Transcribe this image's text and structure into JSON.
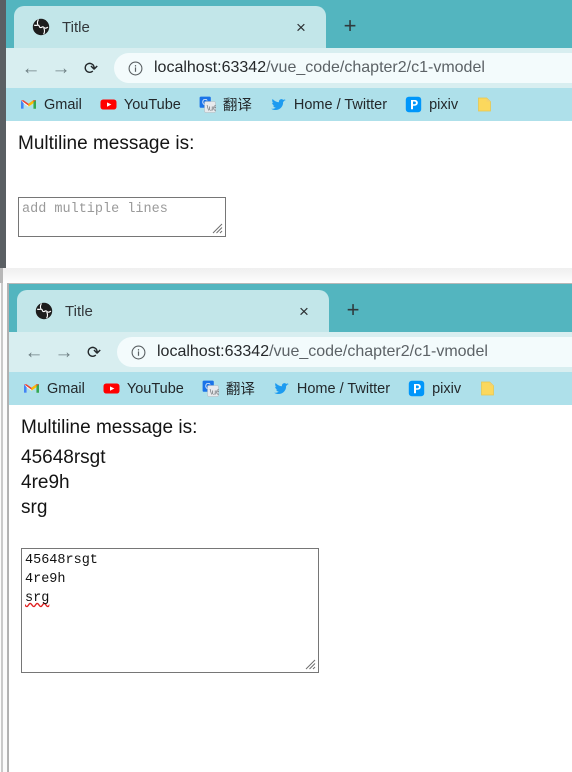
{
  "theme": {
    "tabstrip_color": "#53b5bf",
    "active_tab_color": "#c2e6e9",
    "toolbar_color": "#d8eef0",
    "bookmarks_color": "#aee0ea",
    "omnibox_color": "#f3fbfc",
    "page_background": "#ffffff",
    "spellcheck_underline": "#e02020"
  },
  "browser": {
    "tab": {
      "title": "Title",
      "favicon_name": "globe-favicon",
      "close_label": "×"
    },
    "new_tab_label": "+",
    "nav": {
      "back_label": "←",
      "forward_label": "→",
      "reload_label": "⟳"
    },
    "omnibox": {
      "site_info_icon": "info-circle-icon",
      "url_host": "localhost:63342",
      "url_path": "/vue_code/chapter2/c1-vmodel",
      "url_full": "localhost:63342/vue_code/chapter2/c1-vmodel"
    },
    "bookmarks": [
      {
        "label": "Gmail",
        "icon": "gmail-icon"
      },
      {
        "label": "YouTube",
        "icon": "youtube-icon"
      },
      {
        "label": "翻译",
        "icon": "google-translate-icon"
      },
      {
        "label": "Home / Twitter",
        "icon": "twitter-icon"
      },
      {
        "label": "pixiv",
        "icon": "pixiv-icon"
      },
      {
        "label": "",
        "icon": "bookmark-folder-icon"
      }
    ]
  },
  "window1": {
    "heading": "Multiline message is:",
    "message": "",
    "textarea": {
      "value": "",
      "placeholder": "add multiple lines"
    }
  },
  "window2": {
    "heading": "Multiline message is:",
    "message": "45648rsgt\n4re9h\nsrg",
    "message_lines": [
      "45648rsgt",
      "4re9h",
      "srg"
    ],
    "textarea": {
      "value": "45648rsgt\n4re9h\nsrg",
      "value_lines": [
        "45648rsgt",
        "4re9h",
        "srg"
      ],
      "placeholder": "add multiple lines",
      "misspelled_word": "srg"
    }
  }
}
